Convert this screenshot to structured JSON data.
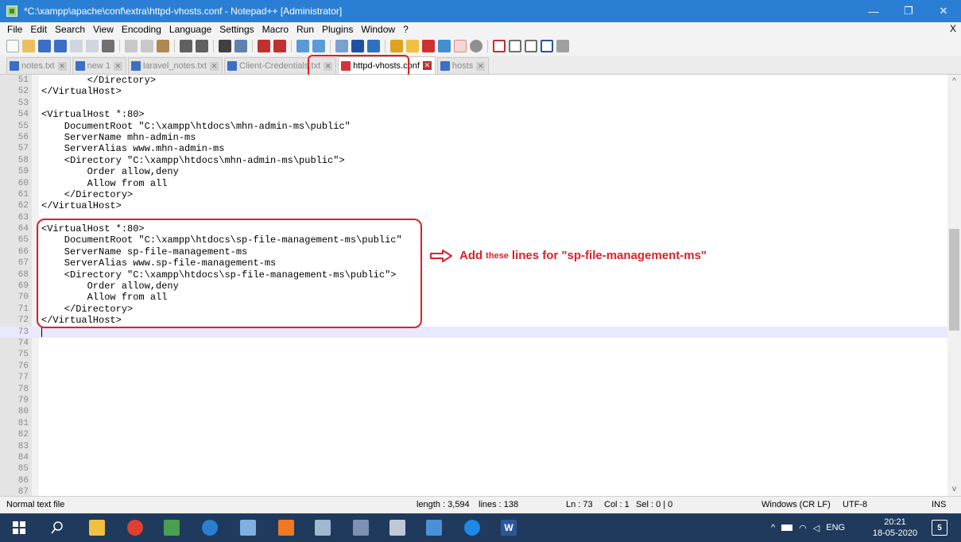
{
  "window": {
    "title": "*C:\\xampp\\apache\\conf\\extra\\httpd-vhosts.conf - Notepad++ [Administrator]",
    "minimize": "—",
    "maximize": "❐",
    "close": "✕"
  },
  "menu": {
    "items": [
      "File",
      "Edit",
      "Search",
      "View",
      "Encoding",
      "Language",
      "Settings",
      "Macro",
      "Run",
      "Plugins",
      "Window",
      "?"
    ],
    "close": "X"
  },
  "toolbar": {
    "buttons": [
      "new",
      "open",
      "save",
      "save-all",
      "close",
      "close-all",
      "print",
      "cut",
      "copy",
      "paste",
      "undo",
      "redo",
      "find",
      "replace",
      "zoom-in",
      "zoom-out",
      "sync-v",
      "sync-h",
      "wrap",
      "all-chars",
      "indent-guide",
      "udl",
      "doc-map",
      "function-list",
      "folder-workspace",
      "monitor",
      "record-macro",
      "stop-macro",
      "play-macro",
      "run-macro",
      "save-macro"
    ]
  },
  "tabs": [
    {
      "label": "notes.txt",
      "active": false,
      "close": "✕"
    },
    {
      "label": "new 1",
      "active": false,
      "close": "✕"
    },
    {
      "label": "laravel_notes.txt",
      "active": false,
      "close": "✕"
    },
    {
      "label": "Client-Credentials.txt",
      "active": false,
      "close": "✕"
    },
    {
      "label": "httpd-vhosts.conf",
      "active": true,
      "close": "✕"
    },
    {
      "label": "hosts",
      "active": false,
      "close": "✕"
    }
  ],
  "editor": {
    "lines": [
      {
        "n": "51",
        "text": "        </Directory>"
      },
      {
        "n": "52",
        "text": "</VirtualHost>"
      },
      {
        "n": "53",
        "text": ""
      },
      {
        "n": "54",
        "text": "<VirtualHost *:80>"
      },
      {
        "n": "55",
        "text": "    DocumentRoot \"C:\\xampp\\htdocs\\mhn-admin-ms\\public\""
      },
      {
        "n": "56",
        "text": "    ServerName mhn-admin-ms"
      },
      {
        "n": "57",
        "text": "    ServerAlias www.mhn-admin-ms"
      },
      {
        "n": "58",
        "text": "    <Directory \"C:\\xampp\\htdocs\\mhn-admin-ms\\public\">"
      },
      {
        "n": "59",
        "text": "        Order allow,deny"
      },
      {
        "n": "60",
        "text": "        Allow from all"
      },
      {
        "n": "61",
        "text": "    </Directory>"
      },
      {
        "n": "62",
        "text": "</VirtualHost>"
      },
      {
        "n": "63",
        "text": ""
      },
      {
        "n": "64",
        "text": "<VirtualHost *:80>"
      },
      {
        "n": "65",
        "text": "    DocumentRoot \"C:\\xampp\\htdocs\\sp-file-management-ms\\public\""
      },
      {
        "n": "66",
        "text": "    ServerName sp-file-management-ms"
      },
      {
        "n": "67",
        "text": "    ServerAlias www.sp-file-management-ms"
      },
      {
        "n": "68",
        "text": "    <Directory \"C:\\xampp\\htdocs\\sp-file-management-ms\\public\">"
      },
      {
        "n": "69",
        "text": "        Order allow,deny"
      },
      {
        "n": "70",
        "text": "        Allow from all"
      },
      {
        "n": "71",
        "text": "    </Directory>"
      },
      {
        "n": "72",
        "text": "</VirtualHost>"
      },
      {
        "n": "73",
        "text": "",
        "current": true
      },
      {
        "n": "74",
        "text": ""
      },
      {
        "n": "75",
        "text": ""
      },
      {
        "n": "76",
        "text": ""
      },
      {
        "n": "77",
        "text": ""
      },
      {
        "n": "78",
        "text": ""
      },
      {
        "n": "79",
        "text": ""
      },
      {
        "n": "80",
        "text": ""
      },
      {
        "n": "81",
        "text": ""
      },
      {
        "n": "82",
        "text": ""
      },
      {
        "n": "83",
        "text": ""
      },
      {
        "n": "84",
        "text": ""
      },
      {
        "n": "85",
        "text": ""
      },
      {
        "n": "86",
        "text": ""
      },
      {
        "n": "87",
        "text": ""
      }
    ],
    "scroll_up": "^",
    "scroll_down": "v"
  },
  "annotation": {
    "part1": "Add",
    "part2": "these",
    "part3": "lines for \"sp-file-management-ms\"",
    "color": "#e0202a"
  },
  "status": {
    "file_type": "Normal text file",
    "length": "length : 3,594",
    "lines": "lines : 138",
    "ln": "Ln : 73",
    "col": "Col : 1",
    "sel": "Sel : 0 | 0",
    "eol": "Windows (CR LF)",
    "encoding": "UTF-8",
    "mode": "INS"
  },
  "taskbar": {
    "apps": [
      "windows-start",
      "search",
      "file-explorer",
      "chrome",
      "sourcetree",
      "maps",
      "notepad",
      "xampp",
      "git",
      "paint",
      "postman",
      "photos",
      "edge",
      "word"
    ],
    "word_label": "W",
    "tray": {
      "chevron": "^",
      "language": "ENG"
    },
    "time": "20:21",
    "date": "18-05-2020",
    "notifications": "5"
  },
  "colors": {
    "titlebar": "#2a7fd4",
    "highlight": "#e02020",
    "taskbar": "#1f3a5c"
  }
}
